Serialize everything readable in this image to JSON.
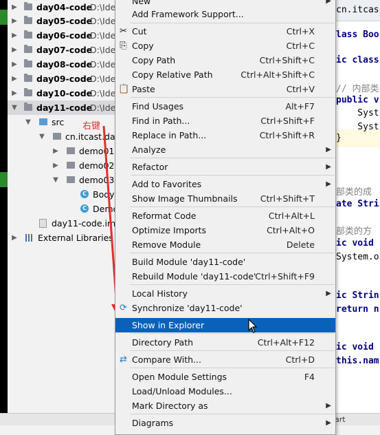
{
  "tree": {
    "items": [
      {
        "name": "day04-code",
        "path": "D:\\Ide"
      },
      {
        "name": "day05-code",
        "path": "D:\\Ide"
      },
      {
        "name": "day06-code",
        "path": "D:\\Ide"
      },
      {
        "name": "day07-code",
        "path": "D:\\Ide"
      },
      {
        "name": "day08-code",
        "path": "D:\\Ide"
      },
      {
        "name": "day09-code",
        "path": "D:\\Ide"
      },
      {
        "name": "day10-code",
        "path": "D:\\Ide"
      },
      {
        "name": "day11-code",
        "path": "D:\\Ide"
      }
    ],
    "src": "src",
    "package": "cn.itcast.day",
    "demo01": "demo01",
    "demo02": "demo02",
    "demo03": "demo03",
    "class_body": "Body",
    "class_demo": "Demo",
    "iml": "day11-code.iml",
    "external": "External Libraries"
  },
  "annotation": "右键",
  "editor": {
    "lines": [
      "cn.itcas",
      "lass Boo",
      "ic class",
      "// 内部类",
      "public v",
      "    Syst",
      "    Syst",
      "}",
      "部类的成",
      "ate Stri",
      "部类的方",
      "ic void",
      "System.o",
      "ic Strin",
      "return n",
      "ic void",
      "this.nam"
    ],
    "bottom_text": "art"
  },
  "context_menu": {
    "items": [
      {
        "label": "New",
        "submenu": true
      },
      {
        "label": "Add Framework Support..."
      },
      {
        "label": "Cut",
        "shortcut": "Ctrl+X",
        "icon": "✂"
      },
      {
        "label": "Copy",
        "shortcut": "Ctrl+C",
        "icon": "⎘"
      },
      {
        "label": "Copy Path",
        "shortcut": "Ctrl+Shift+C"
      },
      {
        "label": "Copy Relative Path",
        "shortcut": "Ctrl+Alt+Shift+C"
      },
      {
        "label": "Paste",
        "shortcut": "Ctrl+V",
        "icon": "📋"
      },
      {
        "label": "Find Usages",
        "shortcut": "Alt+F7"
      },
      {
        "label": "Find in Path...",
        "shortcut": "Ctrl+Shift+F"
      },
      {
        "label": "Replace in Path...",
        "shortcut": "Ctrl+Shift+R"
      },
      {
        "label": "Analyze",
        "submenu": true
      },
      {
        "label": "Refactor",
        "submenu": true
      },
      {
        "label": "Add to Favorites",
        "submenu": true
      },
      {
        "label": "Show Image Thumbnails",
        "shortcut": "Ctrl+Shift+T"
      },
      {
        "label": "Reformat Code",
        "shortcut": "Ctrl+Alt+L"
      },
      {
        "label": "Optimize Imports",
        "shortcut": "Ctrl+Alt+O"
      },
      {
        "label": "Remove Module",
        "shortcut": "Delete"
      },
      {
        "label": "Build Module 'day11-code'"
      },
      {
        "label": "Rebuild Module 'day11-code'",
        "shortcut": "Ctrl+Shift+F9"
      },
      {
        "label": "Local History",
        "submenu": true
      },
      {
        "label": "Synchronize 'day11-code'",
        "icon": "⟳"
      },
      {
        "label": "Show in Explorer"
      },
      {
        "label": "Directory Path",
        "shortcut": "Ctrl+Alt+F12"
      },
      {
        "label": "Compare With...",
        "shortcut": "Ctrl+D",
        "icon": "⇄"
      },
      {
        "label": "Open Module Settings",
        "shortcut": "F4"
      },
      {
        "label": "Load/Unload Modules..."
      },
      {
        "label": "Mark Directory as",
        "submenu": true
      },
      {
        "label": "Diagrams",
        "submenu": true
      }
    ]
  },
  "colors": {
    "menu_highlight": "#0a62b8",
    "annotation": "#e03030"
  }
}
